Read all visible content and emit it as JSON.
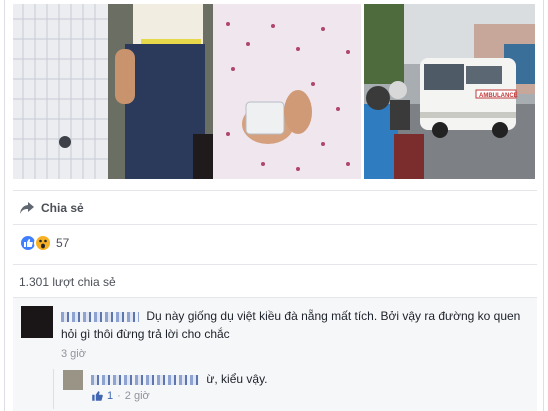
{
  "post": {
    "share_action_label": "Chia sẻ",
    "reaction_count": "57",
    "reaction_icons": [
      "like-icon",
      "wow-icon"
    ],
    "shares_text": "1.301 lượt chia sẻ"
  },
  "photos": {
    "left_image": "photo-hands-money",
    "right_image": "photo-street-ambulance",
    "right_vehicle_text": "AMBULANCE"
  },
  "comments": [
    {
      "text": "Dụ này giống dụ việt kiều đà nẵng mất tích. Bởi vậy ra đường ko quen hỏi gì thôi đừng trả lời cho chắc",
      "time": "3 giờ"
    }
  ],
  "reply": {
    "text": "ừ, kiểu vậy.",
    "likes": "1",
    "separator": "·",
    "time": "2 giờ"
  },
  "colors": {
    "accent": "#4267b2",
    "like": "#4080ff",
    "wow": "#f7b125",
    "muted": "#90949c"
  }
}
